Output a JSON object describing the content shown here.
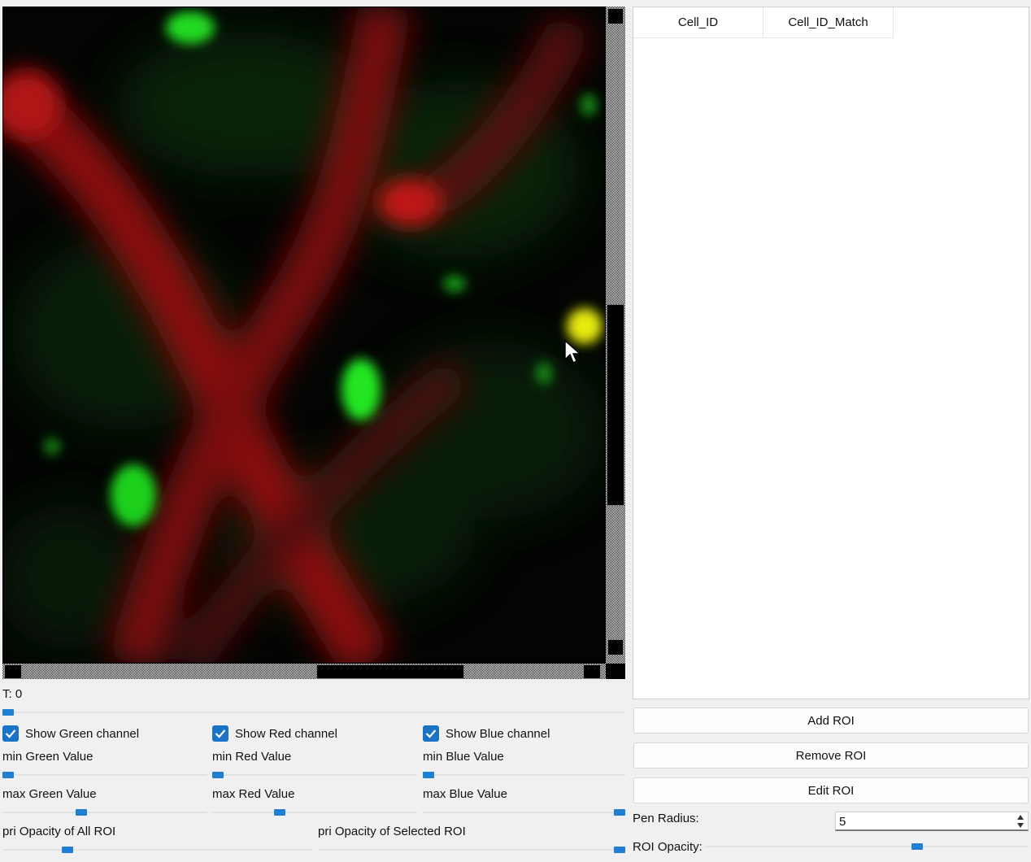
{
  "table": {
    "columns": [
      "Cell_ID",
      "Cell_ID_Match"
    ],
    "rows": []
  },
  "time": {
    "label": "T: 0",
    "value": 0
  },
  "channels": {
    "green": {
      "show_label": "Show Green channel",
      "checked": true,
      "min_label": "min Green Value",
      "max_label": "max Green Value",
      "min_value": 0.0,
      "max_value": 0.38
    },
    "red": {
      "show_label": "Show Red channel",
      "checked": true,
      "min_label": "min Red Value",
      "max_label": "max Red Value",
      "min_value": 0.0,
      "max_value": 0.32
    },
    "blue": {
      "show_label": "Show Blue channel",
      "checked": true,
      "min_label": "min Blue Value",
      "max_label": "max Blue Value",
      "min_value": 0.0,
      "max_value": 1.0
    }
  },
  "opacity": {
    "all_label": "pri Opacity of All ROI",
    "all_value": 0.2,
    "selected_label": "pri Opacity of Selected ROI",
    "selected_value": 1.0
  },
  "buttons": {
    "add": "Add ROI",
    "remove": "Remove ROI",
    "edit": "Edit ROI"
  },
  "pen": {
    "label": "Pen Radius:",
    "value": "5"
  },
  "roi_opacity": {
    "label": "ROI Opacity:",
    "value": 0.66
  },
  "colors": {
    "accent": "#1f7fd4",
    "checkbox": "#1a73c6",
    "green_channel": "#22e020",
    "red_channel": "#c01010"
  },
  "icons": {
    "checkbox": "checkmark-icon",
    "spin_up": "spin-up-icon",
    "spin_down": "spin-down-icon",
    "cursor": "mouse-pointer-icon"
  }
}
